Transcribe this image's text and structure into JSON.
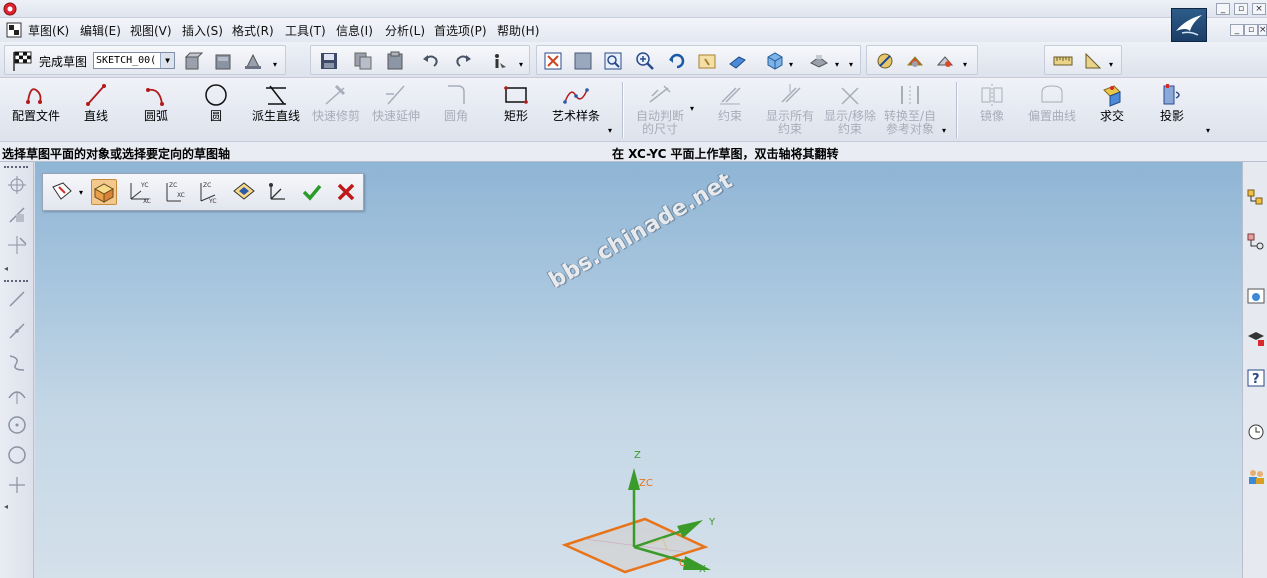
{
  "menu": {
    "items": [
      "草图(K)",
      "编辑(E)",
      "视图(V)",
      "插入(S)",
      "格式(R)",
      "工具(T)",
      "信息(I)",
      "分析(L)",
      "首选项(P)",
      "帮助(H)"
    ]
  },
  "toolbar": {
    "finish_sketch": "完成草图",
    "sketch_name": "SKETCH_00("
  },
  "sketch_tools": [
    {
      "label": "配置文件",
      "icon": "profile-icon",
      "enabled": true
    },
    {
      "label": "直线",
      "icon": "line-icon",
      "enabled": true
    },
    {
      "label": "圆弧",
      "icon": "arc-icon",
      "enabled": true
    },
    {
      "label": "圆",
      "icon": "circle-icon",
      "enabled": true
    },
    {
      "label": "派生直线",
      "icon": "derived-line-icon",
      "enabled": true
    },
    {
      "label": "快速修剪",
      "icon": "quick-trim-icon",
      "enabled": false
    },
    {
      "label": "快速延伸",
      "icon": "quick-extend-icon",
      "enabled": false
    },
    {
      "label": "圆角",
      "icon": "fillet-icon",
      "enabled": false
    },
    {
      "label": "矩形",
      "icon": "rectangle-icon",
      "enabled": true
    },
    {
      "label": "艺术样条",
      "icon": "studio-spline-icon",
      "enabled": true
    }
  ],
  "constraint_tools": [
    {
      "label1": "自动判断",
      "label2": "的尺寸",
      "icon": "inferred-dimension-icon"
    },
    {
      "label1": "约束",
      "label2": "",
      "icon": "constraints-icon"
    },
    {
      "label1": "显示所有",
      "label2": "约束",
      "icon": "show-all-constraints-icon"
    },
    {
      "label1": "显示/移除",
      "label2": "约束",
      "icon": "show-remove-constraints-icon"
    },
    {
      "label1": "转换至/自",
      "label2": "参考对象",
      "icon": "convert-reference-icon"
    }
  ],
  "ops_tools": [
    {
      "label": "镜像",
      "icon": "mirror-icon",
      "enabled": false
    },
    {
      "label": "偏置曲线",
      "icon": "offset-curve-icon",
      "enabled": false
    },
    {
      "label": "求交",
      "icon": "intersect-icon",
      "enabled": true
    },
    {
      "label": "投影",
      "icon": "project-icon",
      "enabled": true
    }
  ],
  "status": {
    "prompt": "选择草图平面的对象或选择要定向的草图轴",
    "message": "在 XC-YC 平面上作草图，双击轴将其翻转"
  },
  "watermark": "bbs.chinade.net",
  "axes": {
    "z": "Z",
    "zc": "ZC",
    "y": "Y",
    "x": "X",
    "xc": "C"
  },
  "colors": {
    "accent_orange": "#e8741a",
    "axis_green": "#3a9a2a",
    "ok_green": "#2a9a2a",
    "cancel_red": "#c01818"
  }
}
